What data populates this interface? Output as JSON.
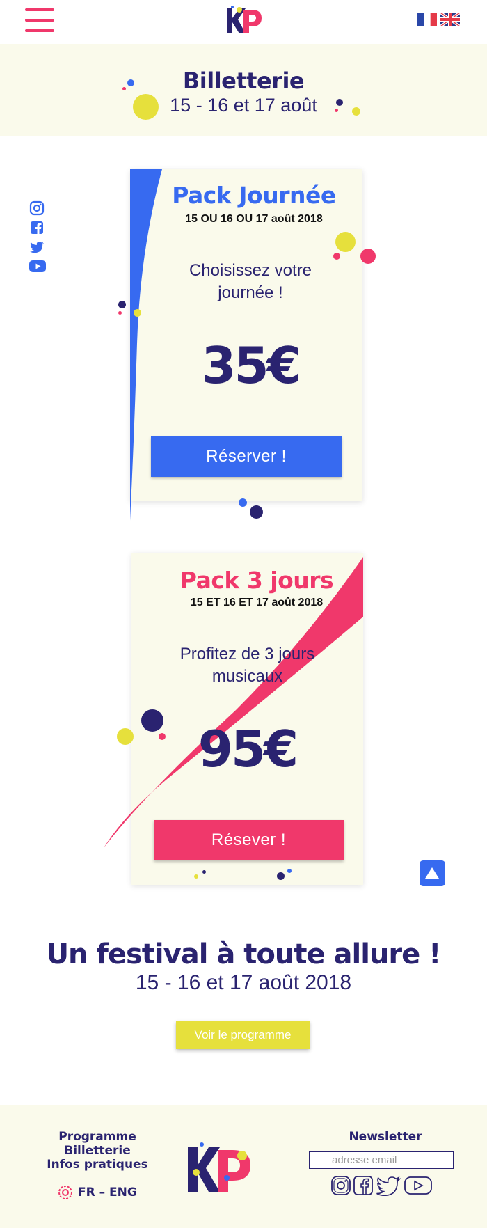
{
  "header": {
    "menu_icon": "hamburger-icon",
    "logo": "KP",
    "languages": [
      "fr-flag",
      "uk-flag"
    ]
  },
  "title_band": {
    "title": "Billetterie",
    "dates": "15 - 16 et 17 août"
  },
  "social_icons": [
    "instagram-icon",
    "facebook-icon",
    "twitter-icon",
    "youtube-icon"
  ],
  "packs": [
    {
      "title": "Pack Journée",
      "date": "15 OU 16 OU 17 août 2018",
      "description_line1": "Choisissez votre",
      "description_line2": "journée !",
      "price": "35€",
      "button": "Réserver !",
      "color": "#376af0"
    },
    {
      "title": "Pack 3 jours",
      "date": "15 ET 16 ET 17 août 2018",
      "description_line1": "Profitez de 3 jours",
      "description_line2": "musicaux",
      "price": "95€",
      "button": "Résever !",
      "color": "#f0386b"
    }
  ],
  "festival": {
    "title": "Un festival à toute allure !",
    "dates": "15 - 16 et 17 août 2018",
    "program_button": "Voir le programme"
  },
  "footer": {
    "links": [
      "Programme",
      "Billetterie",
      "Infos pratiques"
    ],
    "languages": "FR – ENG",
    "newsletter_title": "Newsletter",
    "newsletter_placeholder": "adresse email"
  },
  "colors": {
    "navy": "#2a2370",
    "blue": "#376af0",
    "pink": "#f0386b",
    "yellow": "#e6e03c",
    "cream": "#fafaeb"
  }
}
